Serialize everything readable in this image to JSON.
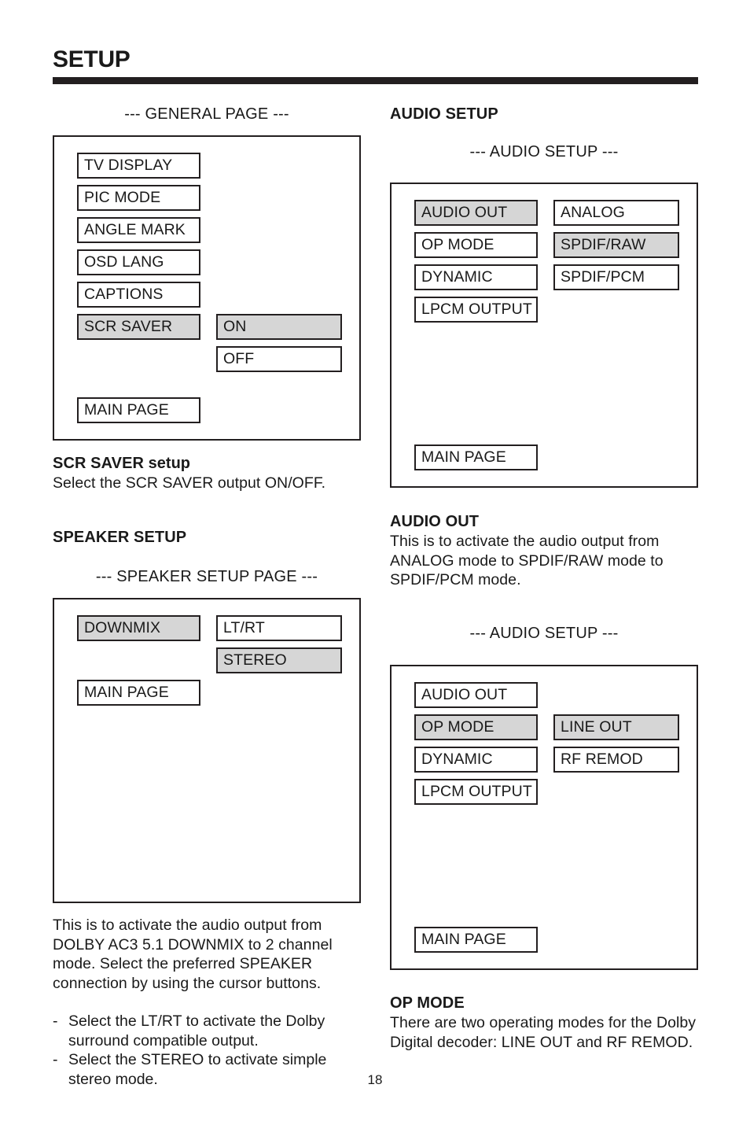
{
  "header": {
    "title": "SETUP",
    "page_number": "18"
  },
  "left_column": {
    "general_screen_label": "--- GENERAL PAGE ---",
    "general_menu": {
      "column_a": [
        {
          "label": "TV DISPLAY",
          "selected": false
        },
        {
          "label": "PIC MODE",
          "selected": false
        },
        {
          "label": "ANGLE MARK",
          "selected": false
        },
        {
          "label": "OSD LANG",
          "selected": false
        },
        {
          "label": "CAPTIONS",
          "selected": false
        },
        {
          "label": "SCR SAVER",
          "selected": true
        }
      ],
      "column_b": [
        {
          "label": "ON",
          "selected": true,
          "row": 5
        },
        {
          "label": "OFF",
          "selected": false,
          "row": 6
        }
      ],
      "main_page_label": "MAIN PAGE"
    },
    "scr_saver_heading_bold": "SCR SAVER",
    "scr_saver_heading_rest": " setup",
    "scr_saver_body": "Select the SCR SAVER output ON/OFF.",
    "speaker_setup_heading": "SPEAKER SETUP",
    "speaker_screen_label": "--- SPEAKER SETUP PAGE ---",
    "speaker_menu": {
      "column_a": [
        {
          "label": "DOWNMIX",
          "selected": true
        }
      ],
      "column_b": [
        {
          "label": "LT/RT",
          "selected": false,
          "row": 0
        },
        {
          "label": "STEREO",
          "selected": true,
          "row": 1
        }
      ],
      "main_page_label": "MAIN PAGE"
    },
    "speaker_body_paragraph": "This is to activate the audio output from DOLBY AC3 5.1 DOWNMIX to 2 channel mode.  Select the preferred SPEAKER connection by using the cursor buttons.",
    "speaker_bullets": [
      {
        "dash": "-",
        "text": "Select the LT/RT to activate the Dolby surround compatible output."
      },
      {
        "dash": "-",
        "text": "Select the STEREO to activate simple stereo mode."
      }
    ]
  },
  "right_column": {
    "audio_setup_heading": "AUDIO SETUP",
    "audio_screen_label_1": "--- AUDIO SETUP ---",
    "audio_menu_1": {
      "column_a": [
        {
          "label": "AUDIO OUT",
          "selected": true
        },
        {
          "label": "OP MODE",
          "selected": false
        },
        {
          "label": "DYNAMIC",
          "selected": false
        },
        {
          "label": "LPCM OUTPUT",
          "selected": false
        }
      ],
      "column_b": [
        {
          "label": "ANALOG",
          "selected": false,
          "row": 0
        },
        {
          "label": "SPDIF/RAW",
          "selected": true,
          "row": 1
        },
        {
          "label": "SPDIF/PCM",
          "selected": false,
          "row": 2
        }
      ],
      "main_page_label": "MAIN PAGE"
    },
    "audio_out_heading": "AUDIO OUT",
    "audio_out_body": "This is to activate the audio output from ANALOG mode to SPDIF/RAW mode to SPDIF/PCM mode.",
    "audio_screen_label_2": "--- AUDIO SETUP ---",
    "audio_menu_2": {
      "column_a": [
        {
          "label": "AUDIO OUT",
          "selected": false
        },
        {
          "label": "OP MODE",
          "selected": true
        },
        {
          "label": "DYNAMIC",
          "selected": false
        },
        {
          "label": "LPCM OUTPUT",
          "selected": false
        }
      ],
      "column_b": [
        {
          "label": "LINE OUT",
          "selected": true,
          "row": 1
        },
        {
          "label": "RF REMOD",
          "selected": false,
          "row": 2
        }
      ],
      "main_page_label": "MAIN PAGE"
    },
    "op_mode_heading": "OP MODE",
    "op_mode_body": "There are two operating modes for the Dolby Digital decoder:  LINE OUT and RF REMOD."
  },
  "colors": {
    "ink": "#231f20",
    "selection_fill": "#d6d6d6",
    "page_background": "#ffffff"
  }
}
